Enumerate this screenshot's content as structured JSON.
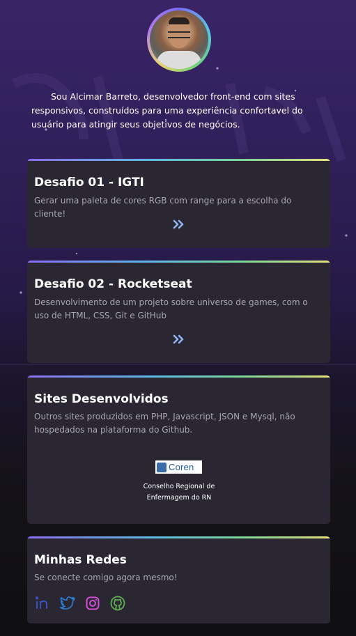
{
  "profile": {
    "avatar_alt": "Alcimar Barreto",
    "intro": "Sou Alcimar Barreto, desenvolvedor front-end com sites responsivos, construídos para uma experiência confortavel do usuário para atingir seus objetivos de negócios."
  },
  "cards": [
    {
      "title": "Desafio 01 - IGTI",
      "description": "Gerar uma paleta de cores RGB com range para a escolha do cliente!",
      "link_icon": "double-chevron-right-icon"
    },
    {
      "title": "Desafio 02 - Rocketseat",
      "description": "Desenvolvimento de um projeto sobre universo de games, com o uso de HTML, CSS, Git e GitHub",
      "link_icon": "double-chevron-right-icon"
    }
  ],
  "sites": {
    "title": "Sites Desenvolvidos",
    "description": "Outros sites produzidos em PHP, Javascript, JSON e Mysql, não hospedados na plataforma do Github.",
    "items": [
      {
        "logo_text": "Coren",
        "caption_line1": "Conselho Regional de",
        "caption_line2": "Enfermagem do RN"
      }
    ]
  },
  "social": {
    "title": "Minhas Redes",
    "description": "Se conecte comigo agora mesmo!",
    "icons": [
      {
        "name": "linkedin-icon",
        "color": "#3b4fb8"
      },
      {
        "name": "twitter-icon",
        "color": "#2a7fd8"
      },
      {
        "name": "instagram-icon",
        "color": "#d14fd6"
      },
      {
        "name": "github-icon",
        "color": "#5fb04f"
      }
    ]
  },
  "colors": {
    "card_bg": "#2a2733",
    "accent_gradient": [
      "#8b6cf0",
      "#5cb9e8",
      "#78d69a",
      "#e6e17a"
    ],
    "chevron": "#8fb3f0"
  }
}
